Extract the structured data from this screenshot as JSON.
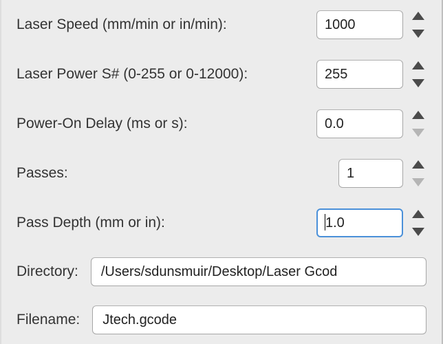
{
  "fields": {
    "laser_speed": {
      "label": "Laser Speed (mm/min or in/min):",
      "value": "1000",
      "down_disabled": false
    },
    "laser_power": {
      "label": "Laser Power S# (0-255 or 0-12000):",
      "value": "255",
      "down_disabled": false
    },
    "power_on_delay": {
      "label": "Power-On Delay (ms or s):",
      "value": "0.0",
      "down_disabled": true
    },
    "passes": {
      "label": "Passes:",
      "value": "1",
      "down_disabled": true
    },
    "pass_depth": {
      "label": "Pass Depth (mm or in):",
      "value": "1.0",
      "down_disabled": false,
      "focused": true
    },
    "directory": {
      "label": "Directory:",
      "value": "/Users/sdunsmuir/Desktop/Laser Gcod"
    },
    "filename": {
      "label": "Filename:",
      "value": "Jtech.gcode"
    }
  }
}
